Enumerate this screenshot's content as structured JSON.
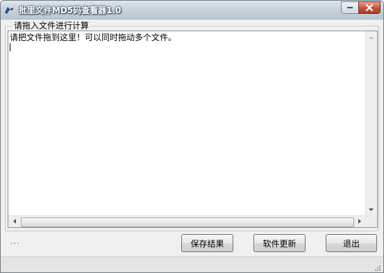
{
  "window": {
    "title": "批里文件MD5码查看器1.0"
  },
  "titlebar_controls": {
    "minimize": "minimize-icon",
    "close": "close-icon"
  },
  "group": {
    "label": "请拖入文件进行计算"
  },
  "textarea": {
    "content": "请把文件拖到这里！可以同时拖动多个文件。"
  },
  "status": {
    "dots": "..."
  },
  "buttons": {
    "save_results": "保存结果",
    "software_update": "软件更新",
    "exit": "退出"
  },
  "colors": {
    "title_bar": "#c9d3dc",
    "close_button": "#c5523a",
    "window_bg": "#f0f0f0"
  }
}
